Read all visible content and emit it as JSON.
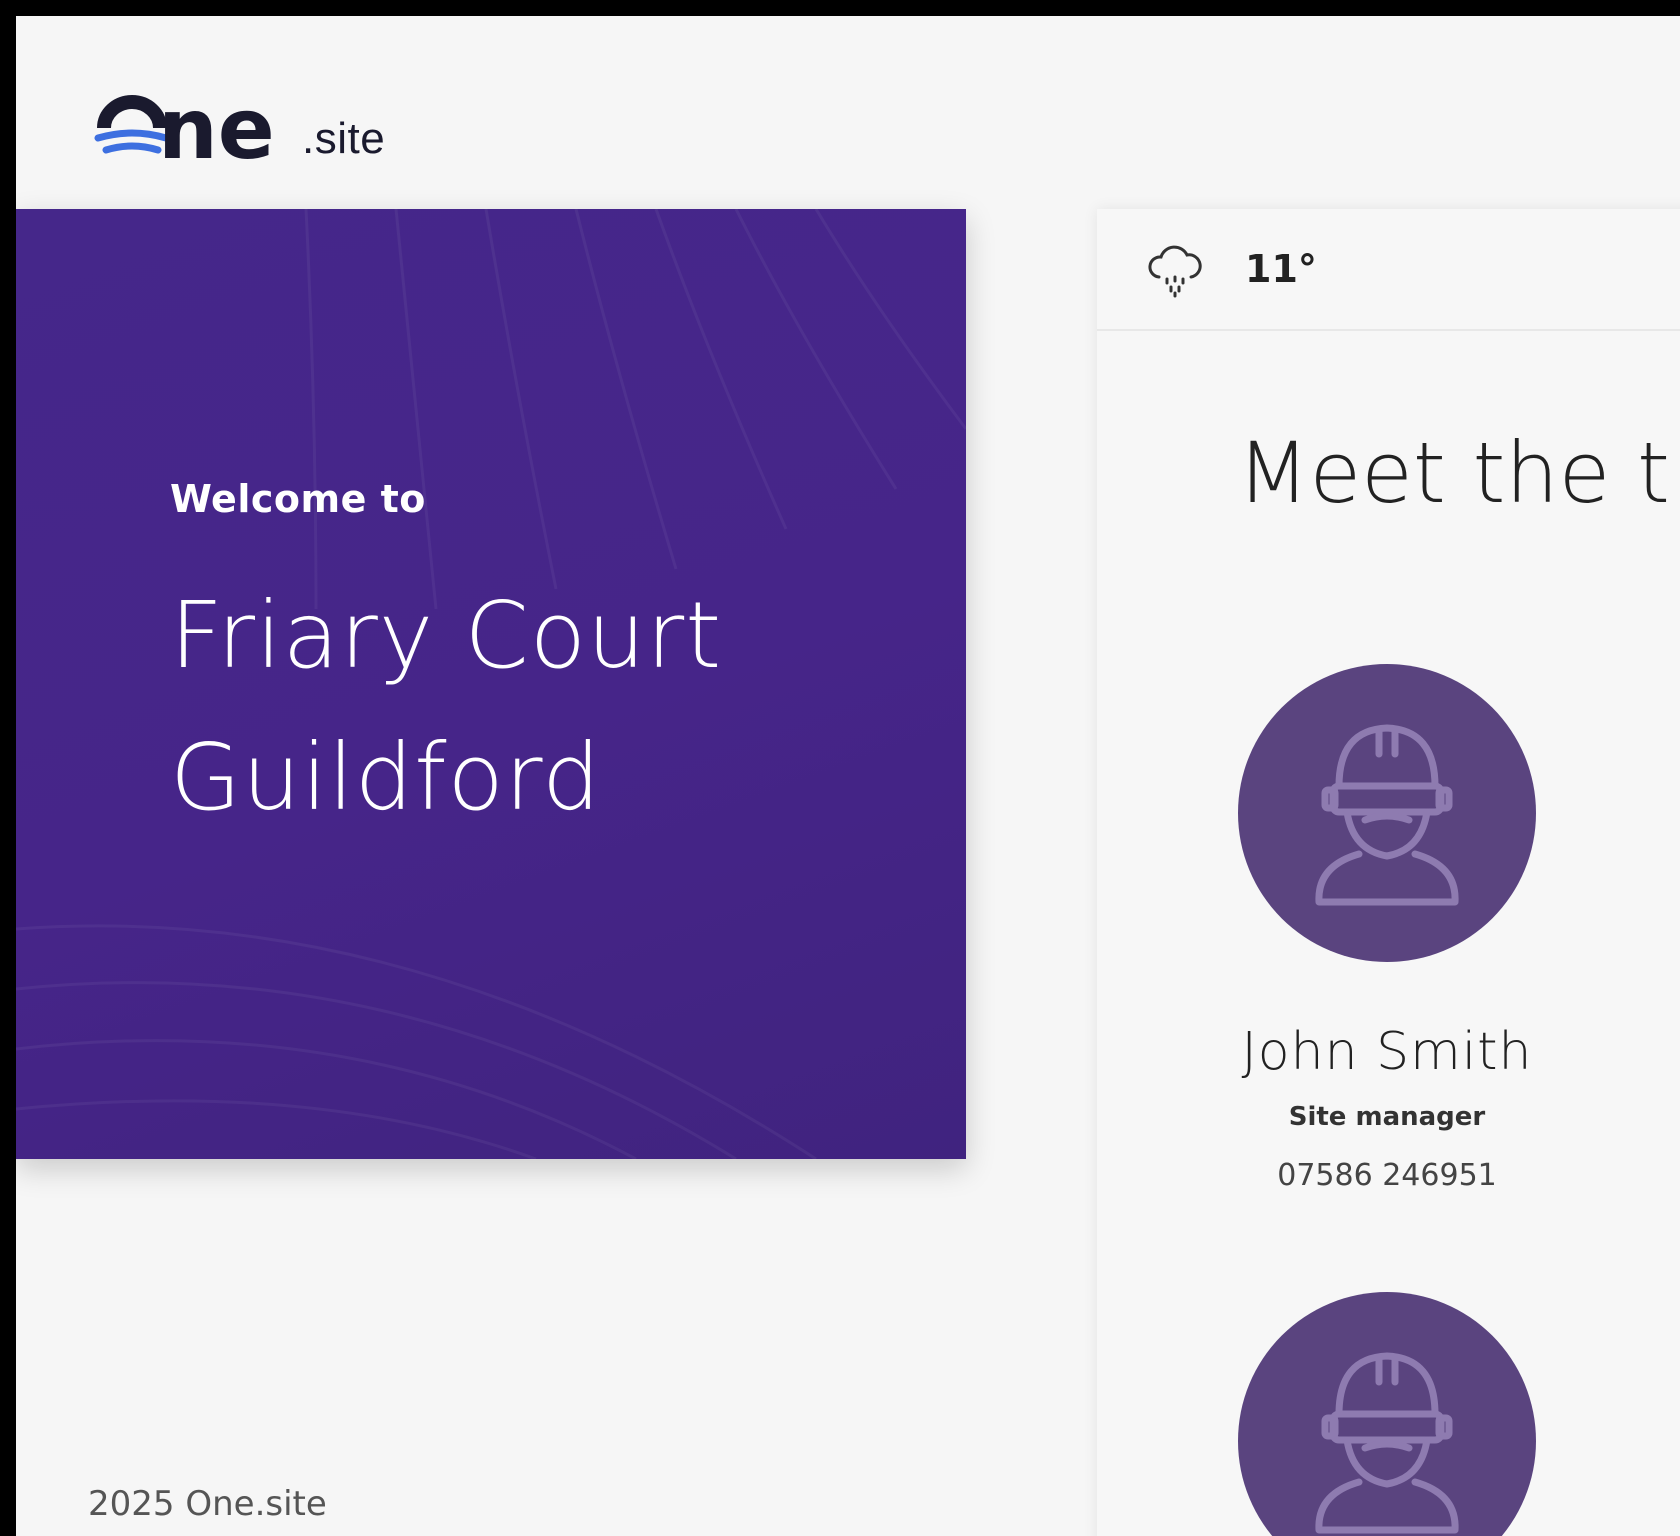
{
  "brand": {
    "logo_text": "one",
    "logo_suffix": ".site",
    "accent_color": "#3d6fe0",
    "footer_copyright": "2025 One.site"
  },
  "welcome": {
    "eyebrow": "Welcome to",
    "site_name_line1": "Friary Court",
    "site_name_line2": "Guildford",
    "background_color": "#45278a"
  },
  "weather": {
    "icon": "rain-cloud-icon",
    "temperature": "11°"
  },
  "team": {
    "heading": "Meet the t",
    "members": [
      {
        "name": "John Smith",
        "role": "Site manager",
        "phone": "07586 246951",
        "avatar_icon": "construction-worker-icon"
      },
      {
        "avatar_icon": "construction-worker-icon"
      }
    ],
    "avatar_color": "#5a447f"
  }
}
